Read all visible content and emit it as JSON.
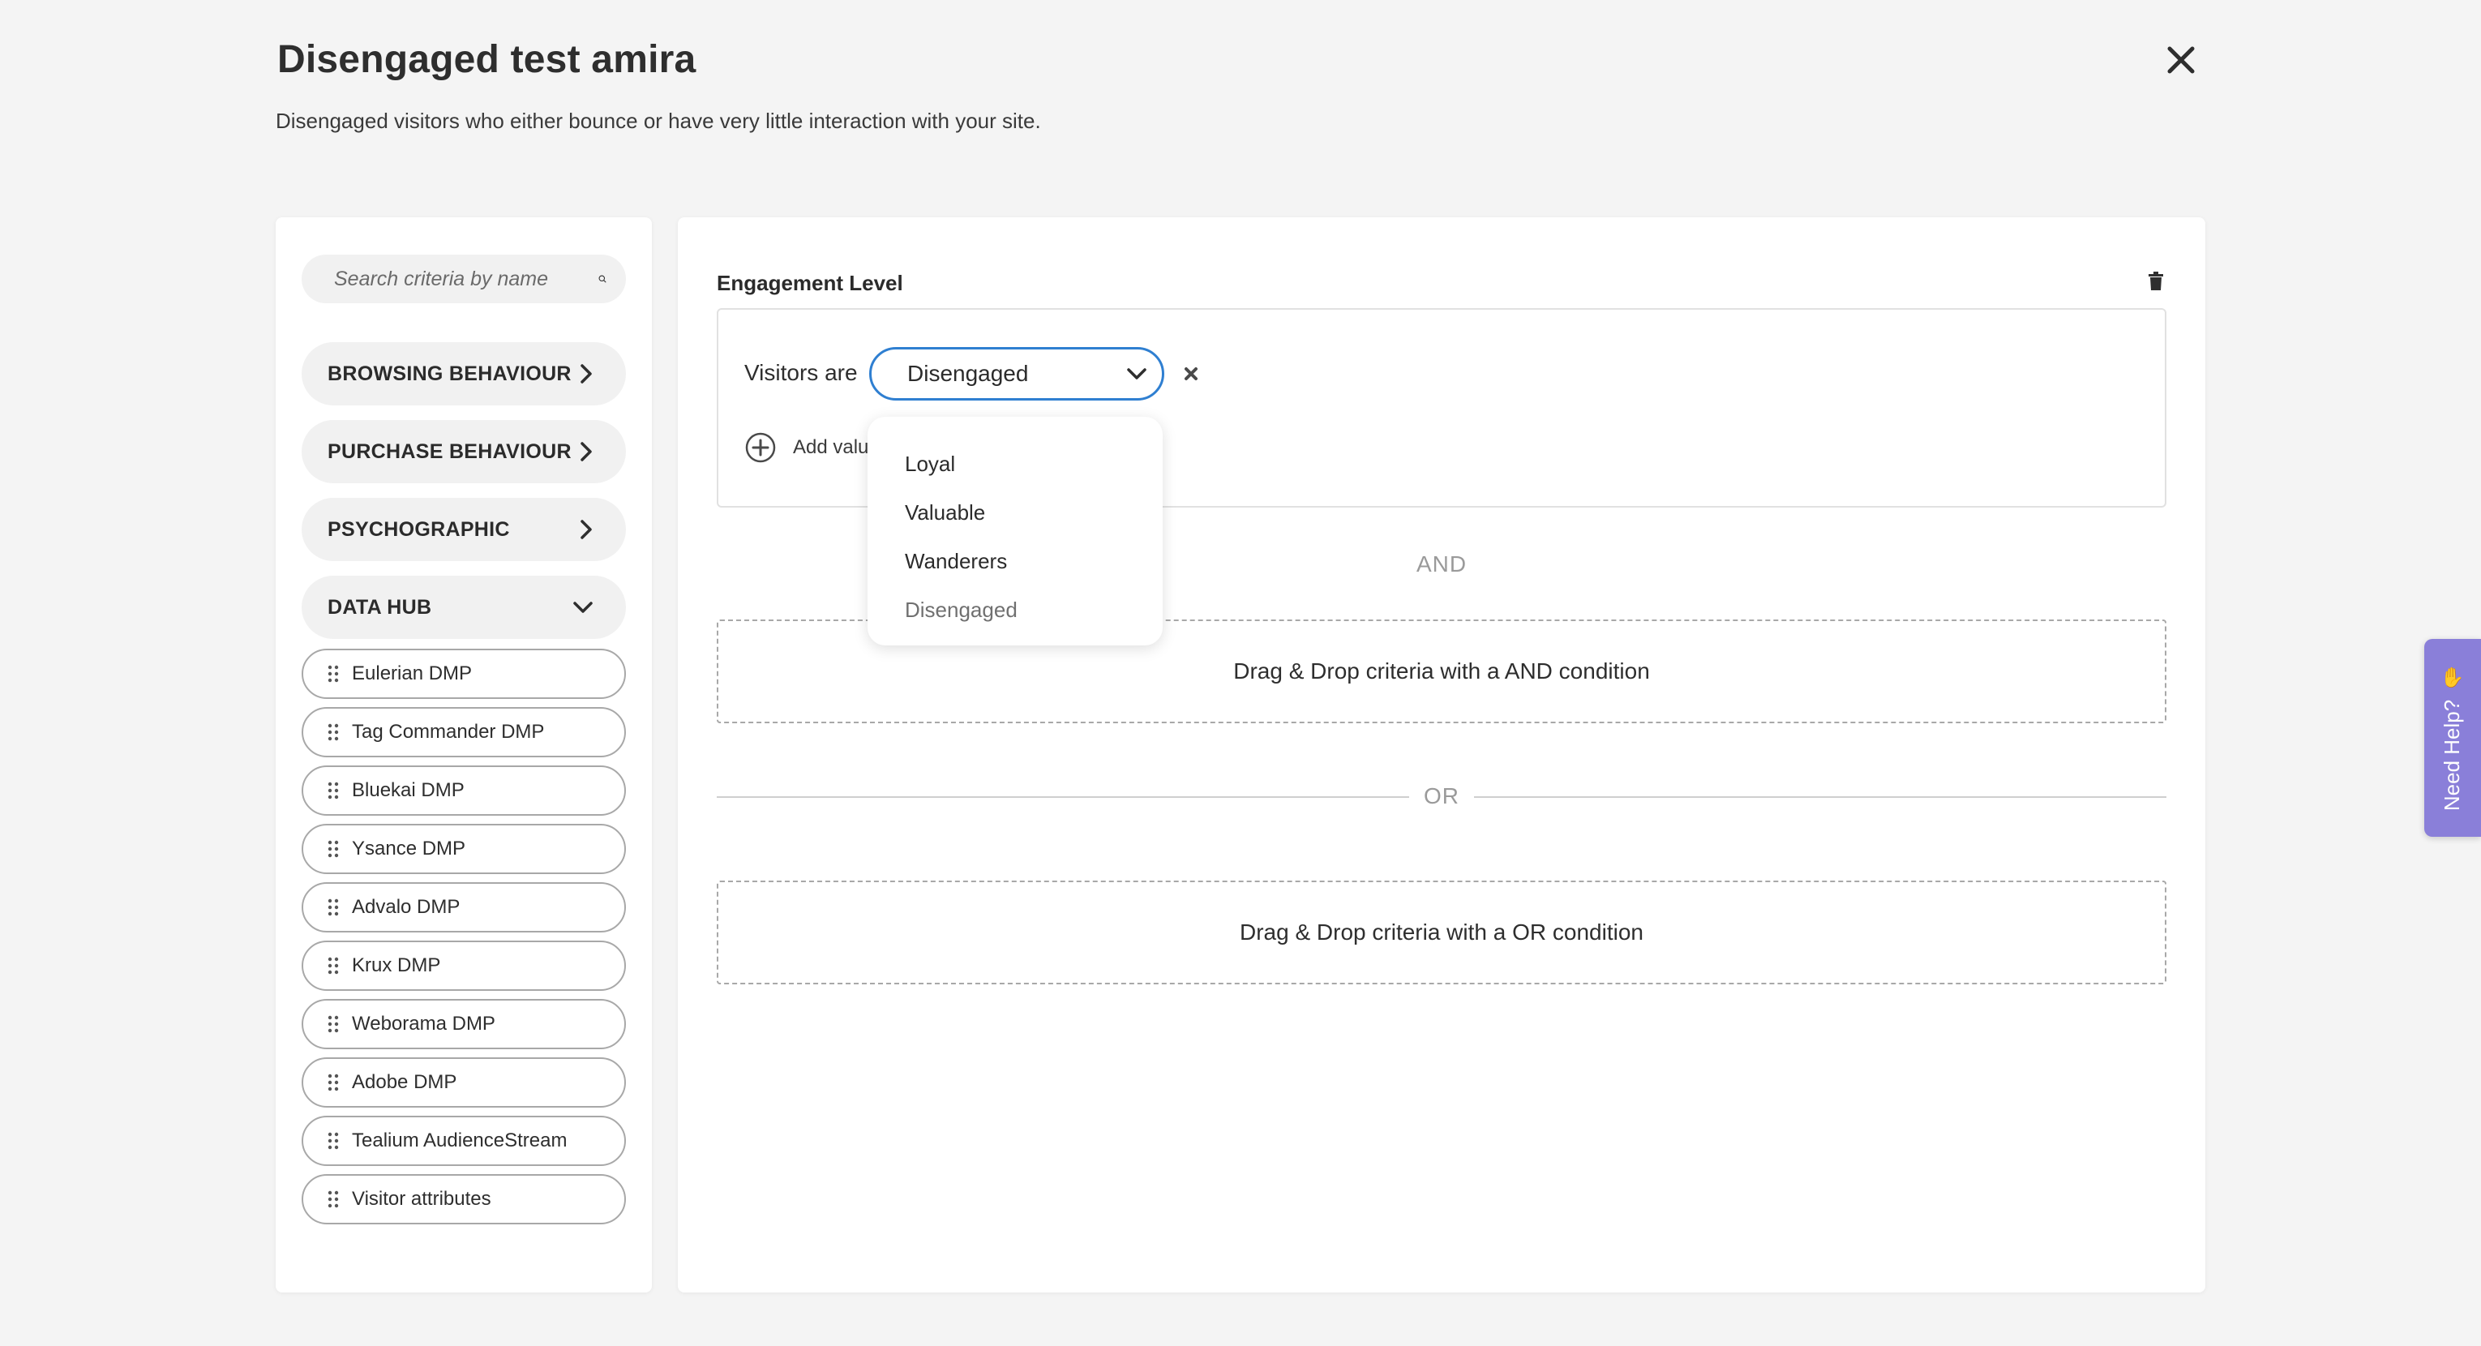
{
  "header": {
    "title": "Disengaged test amira",
    "description": "Disengaged visitors who either bounce or have very little interaction with your site."
  },
  "sidebar": {
    "search_placeholder": "Search criteria by name",
    "categories": [
      {
        "label": "BROWSING BEHAVIOUR",
        "icon": "chevron-right-icon"
      },
      {
        "label": "PURCHASE BEHAVIOUR",
        "icon": "chevron-right-icon"
      },
      {
        "label": "PSYCHOGRAPHIC",
        "icon": "chevron-right-icon"
      },
      {
        "label": "DATA HUB",
        "icon": "chevron-down-icon",
        "expanded": true
      }
    ],
    "data_hub_items": [
      "Eulerian DMP",
      "Tag Commander DMP",
      "Bluekai DMP",
      "Ysance DMP",
      "Advalo DMP",
      "Krux DMP",
      "Weborama DMP",
      "Adobe DMP",
      "Tealium AudienceStream",
      "Visitor attributes"
    ]
  },
  "criteria": {
    "title": "Engagement Level",
    "visitors_label": "Visitors are",
    "selected_value": "Disengaged",
    "add_value_label": "Add valu",
    "options": [
      "Loyal",
      "Valuable",
      "Wanderers",
      "Disengaged"
    ]
  },
  "conditions": {
    "and_label": "AND",
    "and_drop_text": "Drag & Drop criteria with a AND condition",
    "or_label": "OR",
    "or_drop_text": "Drag & Drop criteria with a OR condition"
  },
  "help": {
    "label": "Need Help?"
  },
  "colors": {
    "accent": "#2f7fd1",
    "help_tab": "#8a7fd9",
    "background": "#f4f4f4"
  }
}
